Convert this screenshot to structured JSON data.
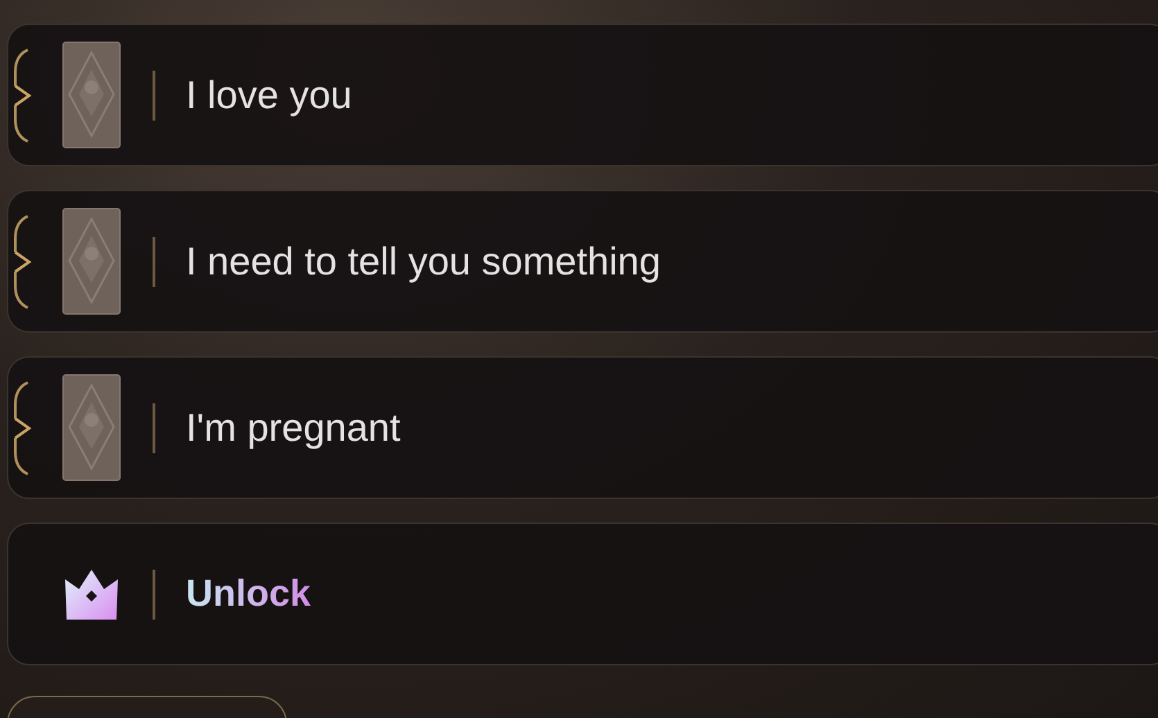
{
  "options": [
    {
      "kind": "reply",
      "text": "I love you"
    },
    {
      "kind": "reply",
      "text": "I need to tell you something"
    },
    {
      "kind": "reply",
      "text": "I'm pregnant"
    },
    {
      "kind": "unlock",
      "text": "Unlock"
    }
  ]
}
